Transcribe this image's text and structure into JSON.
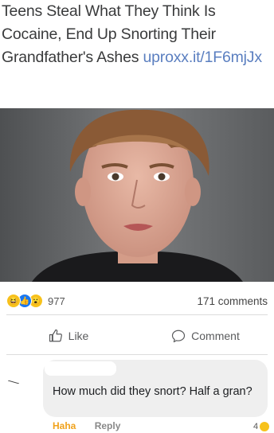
{
  "post": {
    "headline": "Teens Steal What They Think Is Cocaine, End Up Snorting Their Grandfather's Ashes",
    "link_text": "uproxx.it/1F6mjJx"
  },
  "reactions": {
    "icons": [
      "haha-icon",
      "like-icon",
      "wow-icon"
    ],
    "count": "977",
    "comments_label": "171 comments"
  },
  "actions": {
    "like_label": "Like",
    "comment_label": "Comment"
  },
  "comment": {
    "author": "",
    "text": "How much did they snort? Half a gran?",
    "footer_haha": "Haha",
    "footer_reply": "Reply",
    "reaction_count": "4"
  },
  "colors": {
    "link": "#5b7fc0",
    "like_blue": "#1877f2",
    "haha_yellow": "#f7c21b",
    "footer_orange": "#f0a21c"
  }
}
